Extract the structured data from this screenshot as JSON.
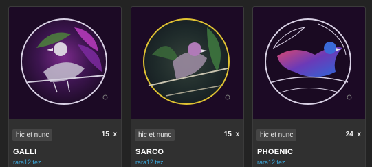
{
  "cards": [
    {
      "platform": "hic et nunc",
      "editions": "15",
      "editions_suffix": "x",
      "title": "GALLI",
      "creator": "rara12.tez"
    },
    {
      "platform": "hic et nunc",
      "editions": "15",
      "editions_suffix": "x",
      "title": "SARCO",
      "creator": "rara12.tez"
    },
    {
      "platform": "hic et nunc",
      "editions": "24",
      "editions_suffix": "x",
      "title": "PHOENIC",
      "creator": "rara12.tez"
    }
  ],
  "colors": {
    "page_bg": "#232323",
    "card_bg": "#303030",
    "link": "#3ea6d8"
  }
}
